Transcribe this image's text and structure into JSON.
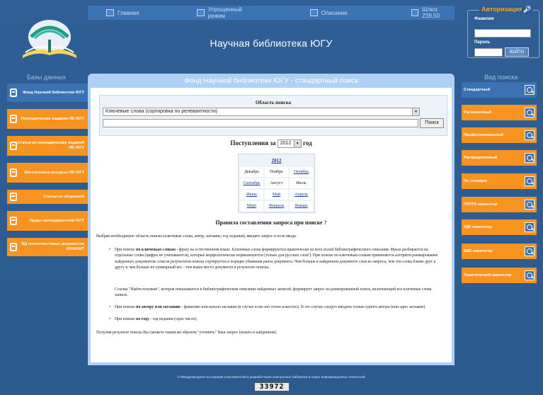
{
  "topnav": {
    "items": [
      {
        "label": "Главная",
        "icon": "home-icon"
      },
      {
        "label": "Упрощенный режим",
        "icon": "simple-mode-icon"
      },
      {
        "label": "Описание",
        "icon": "description-icon"
      },
      {
        "label": "Шлюз Z39.50",
        "icon": "gateway-icon"
      }
    ]
  },
  "header": {
    "title": "Научная библиотека ЮГУ"
  },
  "auth": {
    "title": "Авторизация",
    "surname_label": "Фамилия",
    "password_label": "Пароль",
    "login_button": "ВОЙТИ"
  },
  "left": {
    "heading": "Базы данных",
    "items": [
      {
        "label": "Фонд Научной библиотеки ЮГУ",
        "active": true
      },
      {
        "label": "Периодические издания НБ ЮГУ",
        "active": false
      },
      {
        "label": "Статьи из периодических изданий НБ ЮГУ",
        "active": false
      },
      {
        "label": "Электронные ресурсы НБ ЮГУ",
        "active": false
      },
      {
        "label": "Статьи из сборников",
        "active": false
      },
      {
        "label": "Труды преподавателей ЮГУ",
        "active": false
      },
      {
        "label": "БД полнотекстовых документов ЮНИИИТ",
        "active": false
      }
    ]
  },
  "right": {
    "heading": "Вид поиска",
    "items": [
      {
        "label": "Стандартный",
        "active": true
      },
      {
        "label": "Расширенный",
        "active": false
      },
      {
        "label": "Профессиональный",
        "active": false
      },
      {
        "label": "Распределенный",
        "active": false
      },
      {
        "label": "По словарю",
        "active": false
      },
      {
        "label": "ГРНТИ навигатор",
        "active": false
      },
      {
        "label": "УДК навигатор",
        "active": false
      },
      {
        "label": "ББК навигатор",
        "active": false
      },
      {
        "label": "Тематический навигатор",
        "active": false
      }
    ]
  },
  "main": {
    "title": "Фонд Научной библиотеки ЮГУ - стандартный поиск",
    "search": {
      "area_title": "Область поиска",
      "field_select": "Ключевые слова (сортировка по релевантности)",
      "query_value": "",
      "find_button": "Поиск"
    },
    "arrivals": {
      "label": "Поступления за",
      "year": "2012",
      "suffix": "год"
    },
    "calendar": {
      "year": "2012",
      "months": [
        [
          "Декабрь",
          "Ноябрь",
          "Октябрь"
        ],
        [
          "Сентябрь",
          "Август",
          "Июль"
        ],
        [
          "Июнь",
          "Май",
          "Апрель"
        ],
        [
          "Март",
          "Февраль",
          "Январь"
        ]
      ],
      "links": [
        [
          false,
          false,
          true
        ],
        [
          true,
          false,
          false
        ],
        [
          true,
          true,
          true
        ],
        [
          true,
          true,
          true
        ]
      ]
    },
    "rules_title": "Правила составления запроса при поиске",
    "rules_help": "?",
    "intro": "Выбрав необходимую область поиска (ключевые слова, автор, заглавие, год издания), введите запрос в поле ввода.",
    "rule1_prefix": "При поиске",
    "rule1_bold": "по ключевым словам",
    "rule1_text": " - фразу на естественном языке. Ключевые слова формируются практически из всех полей библиографического описания. Фраза разбирается на отдельные слова (цифры не учитываются), которые морфологически нормализуются (только для русских слов!). При поиске по ключевым словам применяется алгоритм ранжирования найденных документов: список результатов поиска сортируется в порядке убывания ранга документа. Чем больше в найденном документе слов из запроса, чем эти слова ближе друг к другу и чем больше их суммарный вес - тем выше место документа в результате поиска.",
    "similar_text": "Ссылка \"Найти похожие\", которая показывается в библиографическом описании найденных записей, формирует запрос на ранжированный поиск, включающий все ключевые слова записи.",
    "rule2_prefix": "При поиске",
    "rule2_bold": "по автору или заглавию",
    "rule2_text": " - фамилию или начало заглавия (в случае если оно точно известно). В это случае следует вводить только одного автора (или одно заглавие).",
    "rule3_prefix": "При поиске",
    "rule3_bold": "по году",
    "rule3_text": " - год издания (одно число).",
    "outro": "Получив результат поиска Вы сможете таким же образом \"уточнить\" Ваш запрос (искать в найденном)."
  },
  "footer": {
    "text": "© Международная Ассоциация пользователей и разработчиков электронных библиотек и новых информационных технологий",
    "counter": "33972"
  }
}
